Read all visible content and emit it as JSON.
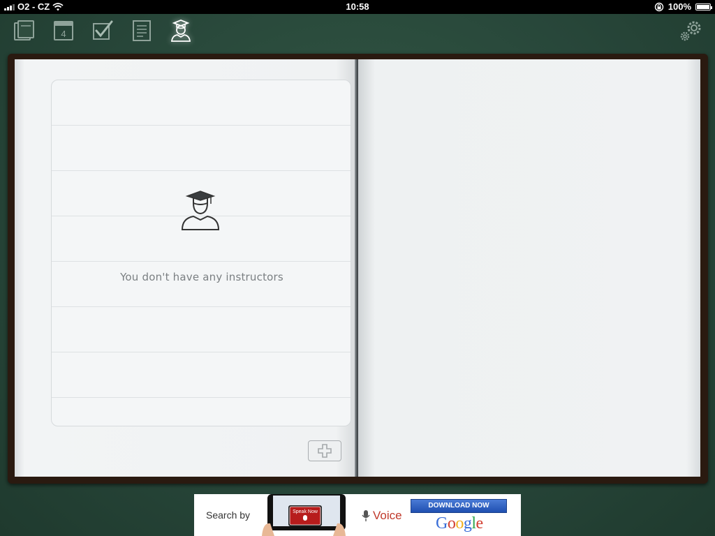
{
  "status_bar": {
    "carrier": "O2 - CZ",
    "time": "10:58",
    "battery": "100%"
  },
  "toolbar": {
    "items": [
      {
        "icon": "notebooks-icon"
      },
      {
        "icon": "calendar-icon",
        "day": "4"
      },
      {
        "icon": "tasks-checkbox-icon"
      },
      {
        "icon": "notes-icon"
      },
      {
        "icon": "instructor-icon",
        "active": true
      }
    ],
    "settings_icon": "gears-icon"
  },
  "instructors": {
    "empty_message": "You don't have any instructors",
    "empty_icon": "graduate-icon"
  },
  "ad": {
    "search_by": "Search by",
    "phone_text": "Speak Now",
    "voice": "Voice",
    "download": "DOWNLOAD NOW",
    "brand": "Google"
  }
}
